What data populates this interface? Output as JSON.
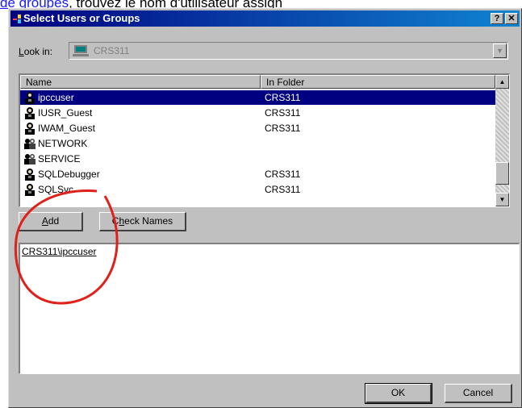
{
  "background": {
    "link_text": "de groupes",
    "trailing_text": ", trouvez le nom d'utilisateur assign"
  },
  "dialog": {
    "title": "Select Users or Groups",
    "help_button": "?",
    "close_button": "✕",
    "look_in": {
      "label_prefix": "L",
      "label_rest": "ook in:",
      "value": "CRS311"
    },
    "list": {
      "columns": [
        "Name",
        "In Folder"
      ],
      "rows": [
        {
          "name": "ipccuser",
          "folder": "CRS311",
          "selected": true,
          "icon": "user-icon"
        },
        {
          "name": "IUSR_Guest",
          "folder": "CRS311",
          "selected": false,
          "icon": "user-icon"
        },
        {
          "name": "IWAM_Guest",
          "folder": "CRS311",
          "selected": false,
          "icon": "user-icon"
        },
        {
          "name": "NETWORK",
          "folder": "",
          "selected": false,
          "icon": "group-icon"
        },
        {
          "name": "SERVICE",
          "folder": "",
          "selected": false,
          "icon": "group-icon"
        },
        {
          "name": "SQLDebugger",
          "folder": "CRS311",
          "selected": false,
          "icon": "user-icon"
        },
        {
          "name": "SQLSvc",
          "folder": "CRS311",
          "selected": false,
          "icon": "user-icon"
        }
      ]
    },
    "add_button": {
      "prefix": "A",
      "rest": "dd"
    },
    "check_names_button": {
      "pre": "C",
      "mnemonic": "h",
      "rest": "eck Names"
    },
    "selected_names": [
      "CRS311\\ipccuser"
    ],
    "ok_button": "OK",
    "cancel_button": "Cancel",
    "colors": {
      "title_start": "#000080",
      "title_end": "#1084d0",
      "face": "#c0c0c0",
      "selection": "#000080",
      "annotation": "#e0201a"
    }
  }
}
